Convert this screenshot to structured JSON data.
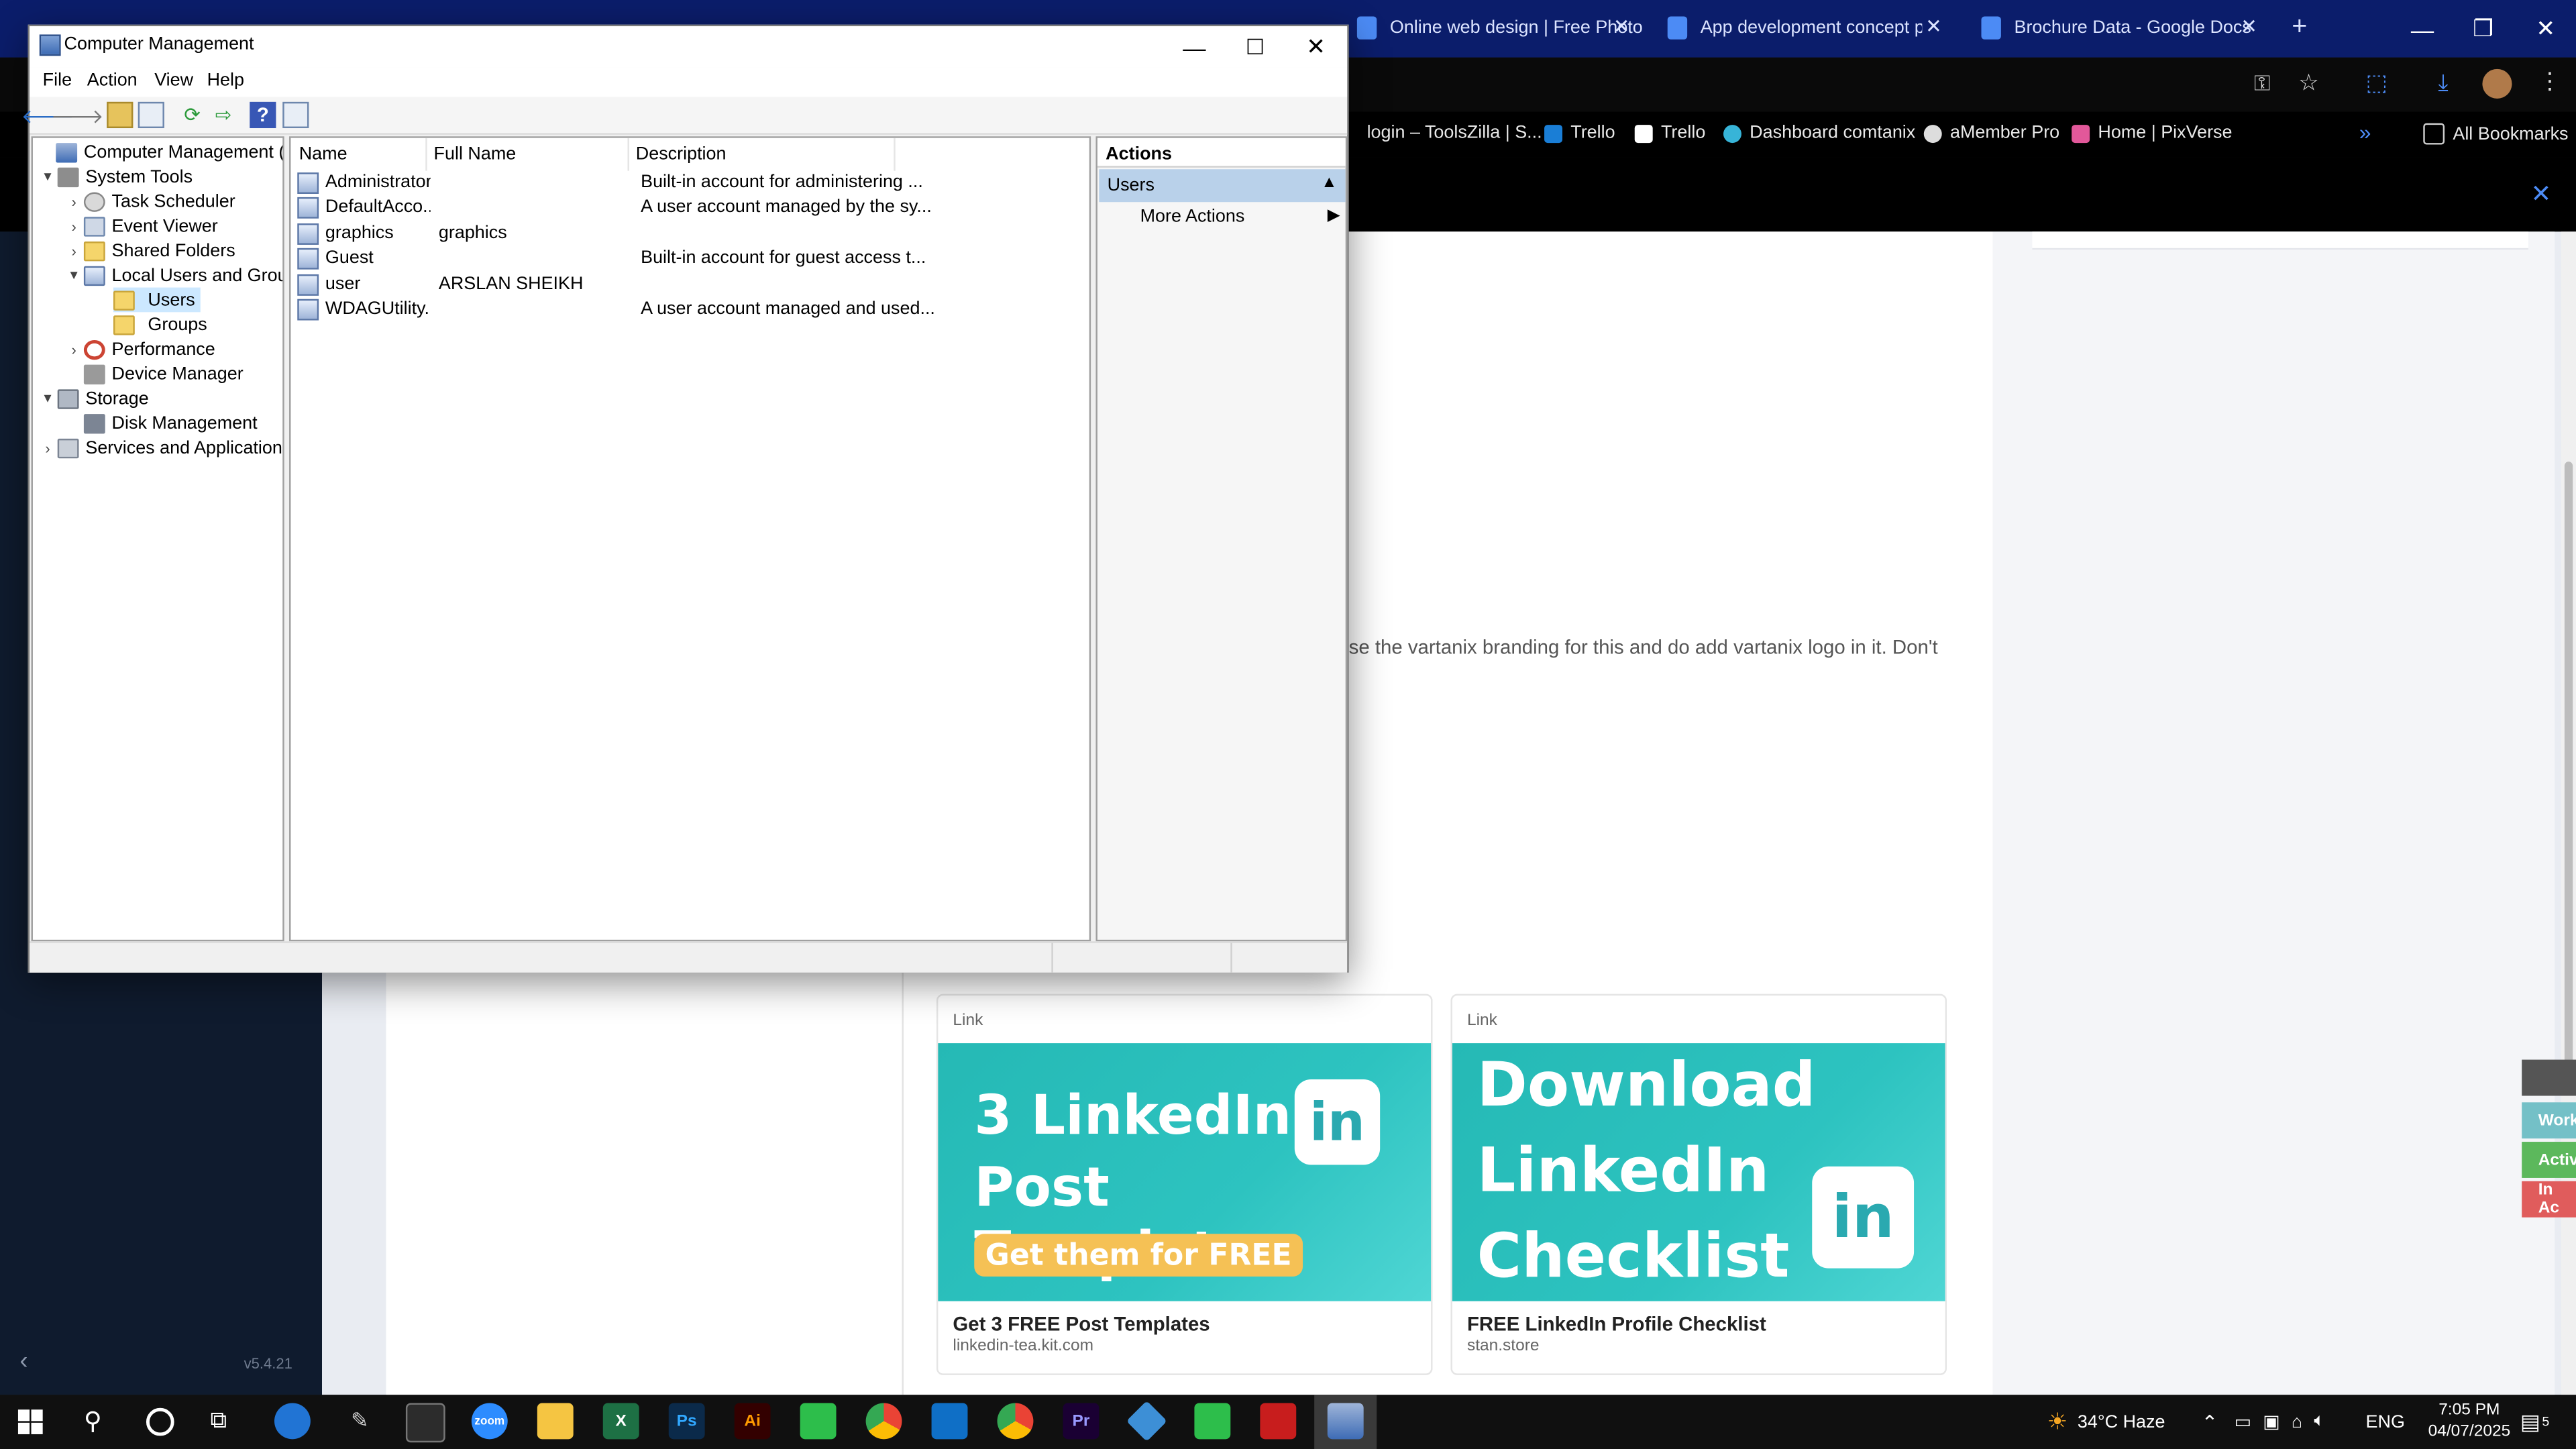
{
  "browser": {
    "tabs": [
      {
        "label": "Online web design | Free Photo"
      },
      {
        "label": "App development concept pen"
      },
      {
        "label": "Brochure Data - Google Docs"
      }
    ],
    "bookmarks": [
      {
        "label": "login – ToolsZilla | S..."
      },
      {
        "label": "Trello"
      },
      {
        "label": "Trello"
      },
      {
        "label": "Dashboard comtanix"
      },
      {
        "label": "aMember Pro"
      },
      {
        "label": "Home | PixVerse"
      },
      {
        "label": "All Bookmarks"
      }
    ],
    "version": "v5.4.21",
    "message_fragment": "se the vartanix branding for this and do add vartanix logo in it. Don't",
    "link_cards": [
      {
        "tag": "Link",
        "img_line1": "3 LinkedIn",
        "img_line2": "Post Templates",
        "img_pill": "Get them for FREE",
        "img_badge": "in",
        "title": "Get 3 FREE Post Templates",
        "domain": "linkedin-tea.kit.com"
      },
      {
        "tag": "Link",
        "img_line1": "Download",
        "img_line2": "LinkedIn",
        "img_line3": "Checklist",
        "img_badge": "in",
        "title": "FREE LinkedIn Profile Checklist",
        "domain": "stan.store"
      }
    ],
    "status_badges": [
      {
        "label": "Work",
        "color": "#74c0c7"
      },
      {
        "label": "Activ",
        "color": "#5cb85c"
      },
      {
        "label": "In Ac",
        "color": "#e05c5c"
      }
    ]
  },
  "window": {
    "title": "Computer Management",
    "menu": [
      "File",
      "Action",
      "View",
      "Help"
    ],
    "tree": [
      {
        "label": "Computer Management (Local)",
        "depth": 0,
        "expander": ""
      },
      {
        "label": "System Tools",
        "depth": 1,
        "expander": "▾"
      },
      {
        "label": "Task Scheduler",
        "depth": 2,
        "expander": "›"
      },
      {
        "label": "Event Viewer",
        "depth": 2,
        "expander": "›"
      },
      {
        "label": "Shared Folders",
        "depth": 2,
        "expander": "›"
      },
      {
        "label": "Local Users and Groups",
        "depth": 2,
        "expander": "▾"
      },
      {
        "label": "Users",
        "depth": 3,
        "expander": "",
        "selected": true
      },
      {
        "label": "Groups",
        "depth": 3,
        "expander": ""
      },
      {
        "label": "Performance",
        "depth": 2,
        "expander": "›"
      },
      {
        "label": "Device Manager",
        "depth": 2,
        "expander": ""
      },
      {
        "label": "Storage",
        "depth": 1,
        "expander": "▾"
      },
      {
        "label": "Disk Management",
        "depth": 2,
        "expander": ""
      },
      {
        "label": "Services and Applications",
        "depth": 1,
        "expander": "›"
      }
    ],
    "columns": [
      "Name",
      "Full Name",
      "Description"
    ],
    "users": [
      {
        "name": "Administrator",
        "full_name": "",
        "description": "Built-in account for administering ..."
      },
      {
        "name": "DefaultAcco...",
        "full_name": "",
        "description": "A user account managed by the sy..."
      },
      {
        "name": "graphics",
        "full_name": "graphics",
        "description": ""
      },
      {
        "name": "Guest",
        "full_name": "",
        "description": "Built-in account for guest access t..."
      },
      {
        "name": "user",
        "full_name": "ARSLAN SHEIKH",
        "description": ""
      },
      {
        "name": "WDAGUtility...",
        "full_name": "",
        "description": "A user account managed and used..."
      }
    ],
    "actions": {
      "header": "Actions",
      "section": "Users",
      "more": "More Actions"
    }
  },
  "taskbar": {
    "apps": [
      "Edge",
      "Zoom",
      "Explorer",
      "Excel",
      "Ps",
      "Ai",
      "Chrome",
      "VS Code",
      "Chrome",
      "Pr",
      "Sync",
      "Acrobat",
      "Computer Management"
    ],
    "weather": "34°C  Haze",
    "lang": "ENG",
    "time": "7:05 PM",
    "date": "04/07/2025",
    "notifications": "5"
  },
  "colors": {
    "browser_tabbar": "#0b1d6b",
    "selection": "#cce8ff",
    "actions_highlight": "#b9d1ea"
  }
}
